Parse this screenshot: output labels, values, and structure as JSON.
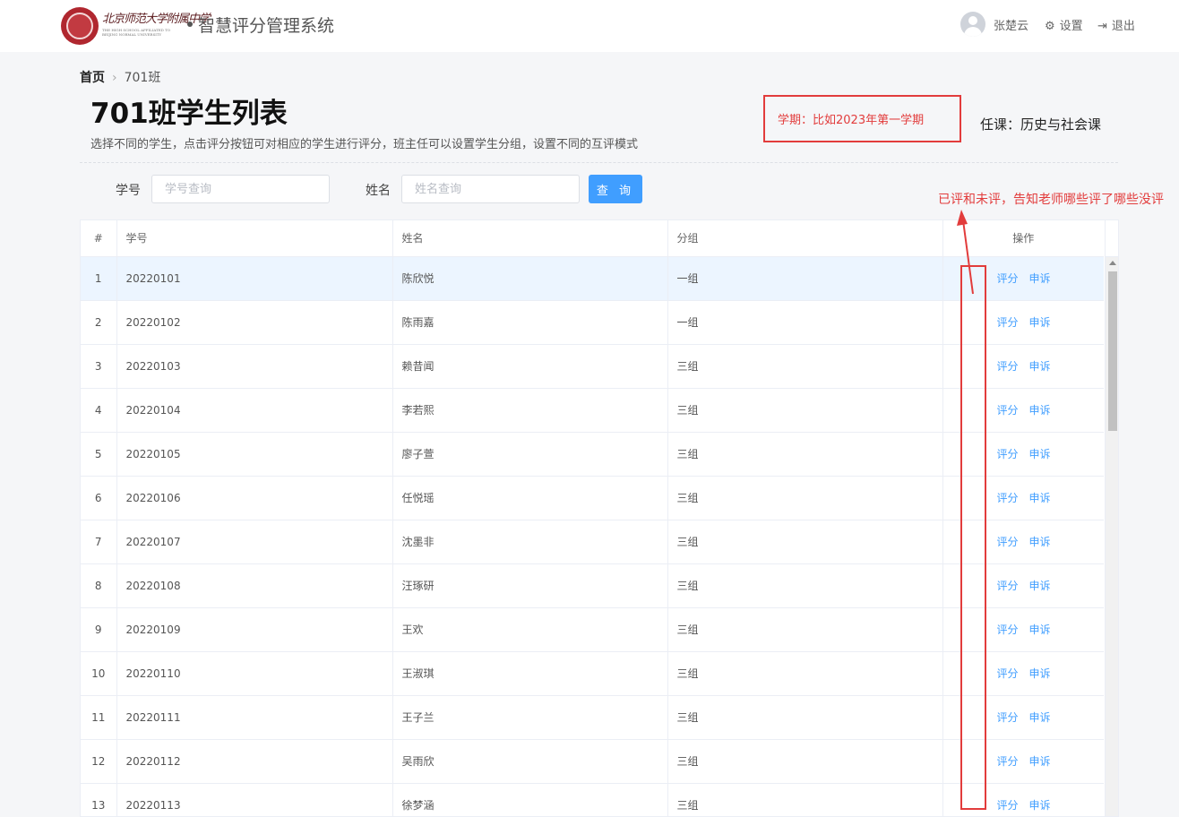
{
  "header": {
    "school_name": "北京师范大学附属中学",
    "school_name_en": "THE HIGH SCHOOL AFFILIATED TO BEIJING NORMAL UNIVERSITY",
    "app_title": "智慧评分管理系统",
    "user_name": "张楚云",
    "settings_label": "设置",
    "logout_label": "退出"
  },
  "breadcrumb": {
    "home": "首页",
    "current": "701班"
  },
  "page": {
    "title": "701班学生列表",
    "description": "选择不同的学生，点击评分按钮可对相应的学生进行评分，班主任可以设置学生分组，设置不同的互评模式",
    "semester": "学期：比如2023年第一学期",
    "course": "任课：历史与社会课"
  },
  "annotation": {
    "note": "已评和未评，告知老师哪些评了哪些没评"
  },
  "search": {
    "student_no_label": "学号",
    "student_no_placeholder": "学号查询",
    "name_label": "姓名",
    "name_placeholder": "姓名查询",
    "query_button": "查 询"
  },
  "table": {
    "columns": [
      "#",
      "学号",
      "姓名",
      "分组",
      "操作"
    ],
    "action_score": "评分",
    "action_appeal": "申诉",
    "rows": [
      {
        "no": "1",
        "id": "20220101",
        "name": "陈欣悦",
        "group": "一组"
      },
      {
        "no": "2",
        "id": "20220102",
        "name": "陈雨嘉",
        "group": "一组"
      },
      {
        "no": "3",
        "id": "20220103",
        "name": "赖昔闻",
        "group": "三组"
      },
      {
        "no": "4",
        "id": "20220104",
        "name": "李若熙",
        "group": "三组"
      },
      {
        "no": "5",
        "id": "20220105",
        "name": "廖子萱",
        "group": "三组"
      },
      {
        "no": "6",
        "id": "20220106",
        "name": "任悦瑶",
        "group": "三组"
      },
      {
        "no": "7",
        "id": "20220107",
        "name": "沈墨非",
        "group": "三组"
      },
      {
        "no": "8",
        "id": "20220108",
        "name": "汪琢研",
        "group": "三组"
      },
      {
        "no": "9",
        "id": "20220109",
        "name": "王欢",
        "group": "三组"
      },
      {
        "no": "10",
        "id": "20220110",
        "name": "王淑琪",
        "group": "三组"
      },
      {
        "no": "11",
        "id": "20220111",
        "name": "王子兰",
        "group": "三组"
      },
      {
        "no": "12",
        "id": "20220112",
        "name": "吴雨欣",
        "group": "三组"
      },
      {
        "no": "13",
        "id": "20220113",
        "name": "徐梦涵",
        "group": "三组"
      }
    ]
  }
}
